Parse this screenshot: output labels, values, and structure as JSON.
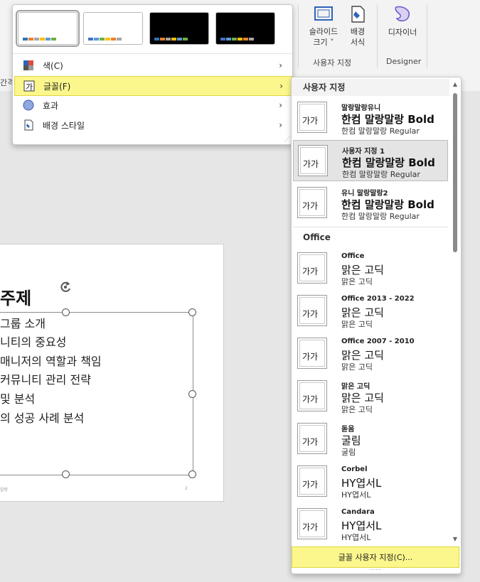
{
  "ribbon": {
    "slide_size_label": "슬라이드\n크기 ˅",
    "background_format_label": "배경\n서식",
    "customize_group_label": "사용자 지정",
    "designer_label": "디자이너",
    "designer_group_label": "Designer",
    "side_cut_text": "간격"
  },
  "theme_menu": {
    "swatches": [
      {
        "name": "white-variant-1",
        "bg": "#ffffff",
        "selected": true,
        "bars": [
          "#2e75b6",
          "#ed7d31",
          "#a5a5a5",
          "#ffc000",
          "#5b9bd5",
          "#70ad47"
        ]
      },
      {
        "name": "white-variant-2",
        "bg": "#ffffff",
        "selected": false,
        "bars": [
          "#4472c4",
          "#5b9bd5",
          "#70ad47",
          "#ffc000",
          "#ed7d31",
          "#a5a5a5"
        ]
      },
      {
        "name": "black-variant-1",
        "bg": "#000000",
        "selected": false,
        "bars": [
          "#2e75b6",
          "#ed7d31",
          "#a5a5a5",
          "#ffc000",
          "#5b9bd5",
          "#70ad47"
        ]
      },
      {
        "name": "black-variant-2",
        "bg": "#000000",
        "selected": false,
        "bars": [
          "#4472c4",
          "#5b9bd5",
          "#70ad47",
          "#ffc000",
          "#ed7d31",
          "#a5a5a5"
        ]
      }
    ],
    "items": [
      {
        "label": "색(C)",
        "icon": "color-palette-icon"
      },
      {
        "label": "글꼴(F)",
        "icon": "font-icon",
        "active": true
      },
      {
        "label": "효과",
        "icon": "effects-icon"
      },
      {
        "label": "배경 스타일",
        "icon": "background-style-icon"
      }
    ]
  },
  "font_menu": {
    "custom_header": "사용자 지정",
    "office_header": "Office",
    "custom_fonts": [
      {
        "name": "말랑말랑유니",
        "heading": "한컴 말랑말랑 Bold",
        "body": "한컴 말랑말랑 Regular",
        "thumb": "가가",
        "selected": false
      },
      {
        "name": "사용자 지정 1",
        "heading": "한컴 말랑말랑 Bold",
        "body": "한컴 말랑말랑 Regular",
        "thumb": "가가",
        "selected": true
      },
      {
        "name": "유니 말랑말랑2",
        "heading": "한컴 말랑말랑 Bold",
        "body": "한컴 말랑말랑 Regular",
        "thumb": "가가",
        "selected": false
      }
    ],
    "office_fonts": [
      {
        "name": "Office",
        "heading": "맑은 고딕",
        "body": "맑은 고딕",
        "thumb": "가가"
      },
      {
        "name": "Office 2013 - 2022",
        "heading": "맑은 고딕",
        "body": "맑은 고딕",
        "thumb": "가가"
      },
      {
        "name": "Office 2007 - 2010",
        "heading": "맑은 고딕",
        "body": "맑은 고딕",
        "thumb": "가가"
      },
      {
        "name": "맑은 고딕",
        "heading": "맑은 고딕",
        "body": "맑은 고딕",
        "thumb": "가가"
      },
      {
        "name": "돋움",
        "heading": "굴림",
        "body": "굴림",
        "thumb": "가가"
      },
      {
        "name": "Corbel",
        "heading": "HY엽서L",
        "body": "HY엽서L",
        "thumb": "가가"
      },
      {
        "name": "Candara",
        "heading": "HY엽서L",
        "body": "HY엽서L",
        "thumb": "가가"
      }
    ],
    "customize_label": "글꼴 사용자 지정(C)..."
  },
  "slide": {
    "title": "주제",
    "bullets": [
      "그룹 소개",
      "니티의 중요성",
      "매니저의 역할과 책임",
      "커뮤니티 관리 전략",
      "및 분석",
      "의 성공 사례 분석"
    ],
    "footer_left": "말랑",
    "page_number": "2"
  },
  "colors": {
    "highlight": "#fbf78c",
    "highlight_border": "#e0d540",
    "selected_item": "#e4e4e4"
  }
}
